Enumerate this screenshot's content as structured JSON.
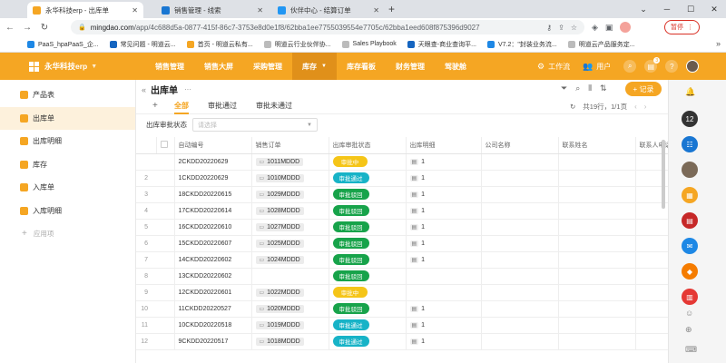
{
  "browser": {
    "tabs": [
      {
        "title": "永华科技erp - 出库单",
        "color": "#f5a623"
      },
      {
        "title": "销售管理 - 线索",
        "color": "#1976d2"
      },
      {
        "title": "伙伴中心 - 结算订单",
        "color": "#2196f3"
      }
    ],
    "url_host": "mingdao.com",
    "url_path": "/app/4c688d5a-0877-415f-86c7-3753e8d0e1f8/62bba1ee7755039554e7705c/62bba1eed608f875396d9027",
    "pause_label": "暂停",
    "bookmarks": [
      {
        "label": "PaaS_hpaPaaS_企...",
        "color": "#1e88e5"
      },
      {
        "label": "常见问题 - 明道云...",
        "color": "#1565c0"
      },
      {
        "label": "首页 - 明道云私有...",
        "color": "#f5a623"
      },
      {
        "label": "明道云行业伙伴协...",
        "color": "#bbb"
      },
      {
        "label": "Sales Playbook",
        "color": "#bbb"
      },
      {
        "label": "天眼查-商业查询平...",
        "color": "#1565c0"
      },
      {
        "label": "V7.2：\"封装业务流...",
        "color": "#1e88e5"
      },
      {
        "label": "明道云产品服务定...",
        "color": "#bbb"
      }
    ],
    "bookmarks_more": "»"
  },
  "app": {
    "name": "永华科技erp",
    "nav": [
      {
        "label": "销售管理",
        "active": false
      },
      {
        "label": "销售大屏",
        "active": false
      },
      {
        "label": "采购管理",
        "active": false
      },
      {
        "label": "库存",
        "active": true
      },
      {
        "label": "库存看板",
        "active": false
      },
      {
        "label": "财务管理",
        "active": false
      },
      {
        "label": "驾驶舱",
        "active": false
      }
    ],
    "workspace_label": "工作流",
    "user_label": "用户",
    "notification_count": "3"
  },
  "sidebar": {
    "items": [
      {
        "label": "产品表",
        "active": false
      },
      {
        "label": "出库单",
        "active": true
      },
      {
        "label": "出库明细",
        "active": false
      },
      {
        "label": "库存",
        "active": false
      },
      {
        "label": "入库单",
        "active": false
      },
      {
        "label": "入库明细",
        "active": false
      }
    ],
    "add_label": "应用项"
  },
  "view": {
    "title": "出库单",
    "add_record_label": "+ 记录",
    "subtabs": [
      {
        "label": "全部",
        "active": true
      },
      {
        "label": "审批通过",
        "active": false
      },
      {
        "label": "审批未通过",
        "active": false
      }
    ],
    "pager_text": "共19行，1/1页",
    "filter_label": "出库审批状态",
    "filter_placeholder": "请选择",
    "columns": [
      "自动编号",
      "销售订单",
      "出库审批状态",
      "出库明细",
      "公司名称",
      "联系姓名",
      "联系人电话"
    ],
    "rows": [
      {
        "num": "",
        "code": "2CKDD20220629",
        "order": "1011MDDD",
        "status": "审批中",
        "status_color": "#f5c518",
        "detail": "1"
      },
      {
        "num": "2",
        "code": "1CKDD20220629",
        "order": "1010MDDD",
        "status": "审批通过",
        "status_color": "#17b3c7",
        "detail": "1"
      },
      {
        "num": "3",
        "code": "18CKDD20220615",
        "order": "1029MDDD",
        "status": "审批驳回",
        "status_color": "#17a34a",
        "detail": "1"
      },
      {
        "num": "4",
        "code": "17CKDD20220614",
        "order": "1028MDDD",
        "status": "审批驳回",
        "status_color": "#17a34a",
        "detail": "1"
      },
      {
        "num": "5",
        "code": "16CKDD20220610",
        "order": "1027MDDD",
        "status": "审批驳回",
        "status_color": "#17a34a",
        "detail": "1"
      },
      {
        "num": "6",
        "code": "15CKDD20220607",
        "order": "1025MDDD",
        "status": "审批驳回",
        "status_color": "#17a34a",
        "detail": "1"
      },
      {
        "num": "7",
        "code": "14CKDD20220602",
        "order": "1024MDDD",
        "status": "审批驳回",
        "status_color": "#17a34a",
        "detail": "1"
      },
      {
        "num": "8",
        "code": "13CKDD20220602",
        "order": "",
        "status": "审批驳回",
        "status_color": "#17a34a",
        "detail": ""
      },
      {
        "num": "9",
        "code": "12CKDD20220601",
        "order": "1022MDDD",
        "status": "审批中",
        "status_color": "#f5c518",
        "detail": ""
      },
      {
        "num": "10",
        "code": "11CKDD20220527",
        "order": "1020MDDD",
        "status": "审批驳回",
        "status_color": "#17a34a",
        "detail": "1"
      },
      {
        "num": "11",
        "code": "10CKDD20220518",
        "order": "1019MDDD",
        "status": "审批通过",
        "status_color": "#17b3c7",
        "detail": "1"
      },
      {
        "num": "12",
        "code": "9CKDD20220517",
        "order": "1018MDDD",
        "status": "审批通过",
        "status_color": "#17b3c7",
        "detail": "1"
      }
    ]
  }
}
